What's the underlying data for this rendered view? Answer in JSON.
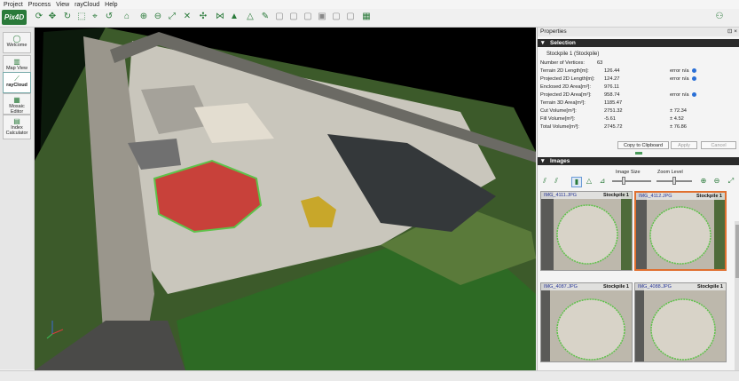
{
  "menu": [
    "Project",
    "Process",
    "View",
    "rayCloud",
    "Help"
  ],
  "logo_text": "Pix4D",
  "sidebar": [
    {
      "label": "Welcome",
      "icon": "home-icon"
    },
    {
      "label": "Map View",
      "icon": "map-icon"
    },
    {
      "label": "rayCloud",
      "icon": "raycloud-icon"
    },
    {
      "label": "Mosaic Editor",
      "icon": "mosaic-icon"
    },
    {
      "label": "Index Calculator",
      "icon": "index-calculator-icon"
    }
  ],
  "properties": {
    "title": "Properties",
    "controls": "⊡ ×",
    "selection_title": "Selection",
    "selection_name": "Stockpile 1 (Stockpile)",
    "rows": [
      {
        "label": "Number of Vertices:",
        "value": "63",
        "error": ""
      },
      {
        "label": "Terrain 2D Length[m]:",
        "value": "126.44",
        "error": "error n/a"
      },
      {
        "label": "Projected 2D Length[m]:",
        "value": "124.27",
        "error": "error n/a"
      },
      {
        "label": "Enclosed 2D Area[m²]:",
        "value": "976.11",
        "error": ""
      },
      {
        "label": "Projected 2D Area[m²]:",
        "value": "958.74",
        "error": "error n/a"
      },
      {
        "label": "Terrain 3D Area[m²]:",
        "value": "1185.47",
        "error": ""
      },
      {
        "label": "Cut Volume[m³]:",
        "value": "2751.32",
        "error": "± 72.34"
      },
      {
        "label": "Fill Volume[m³]:",
        "value": "-5.61",
        "error": "± 4.52"
      },
      {
        "label": "Total Volume[m³]:",
        "value": "2745.72",
        "error": "± 76.86"
      }
    ],
    "copy_button": "Copy to Clipboard",
    "apply_button": "Apply",
    "cancel_button": "Cancel"
  },
  "images": {
    "title": "Images",
    "image_size_label": "Image Size",
    "zoom_level_label": "Zoom Level",
    "image_size_level": 0.3,
    "zoom_level": 0.5,
    "thumbnails": [
      {
        "name": "IMG_4111.JPG",
        "tag": "Stockpile 1",
        "selected": false
      },
      {
        "name": "IMG_4112.JPG",
        "tag": "Stockpile 1",
        "selected": true
      },
      {
        "name": "IMG_4087.JPG",
        "tag": "Stockpile 1",
        "selected": false
      },
      {
        "name": "IMG_4088.JPG",
        "tag": "Stockpile 1",
        "selected": false
      }
    ]
  },
  "colors": {
    "accent": "#2a7a3a",
    "selection": "#e07030",
    "stockpile_fill": "#c8413a",
    "outline": "#5ec24a"
  }
}
